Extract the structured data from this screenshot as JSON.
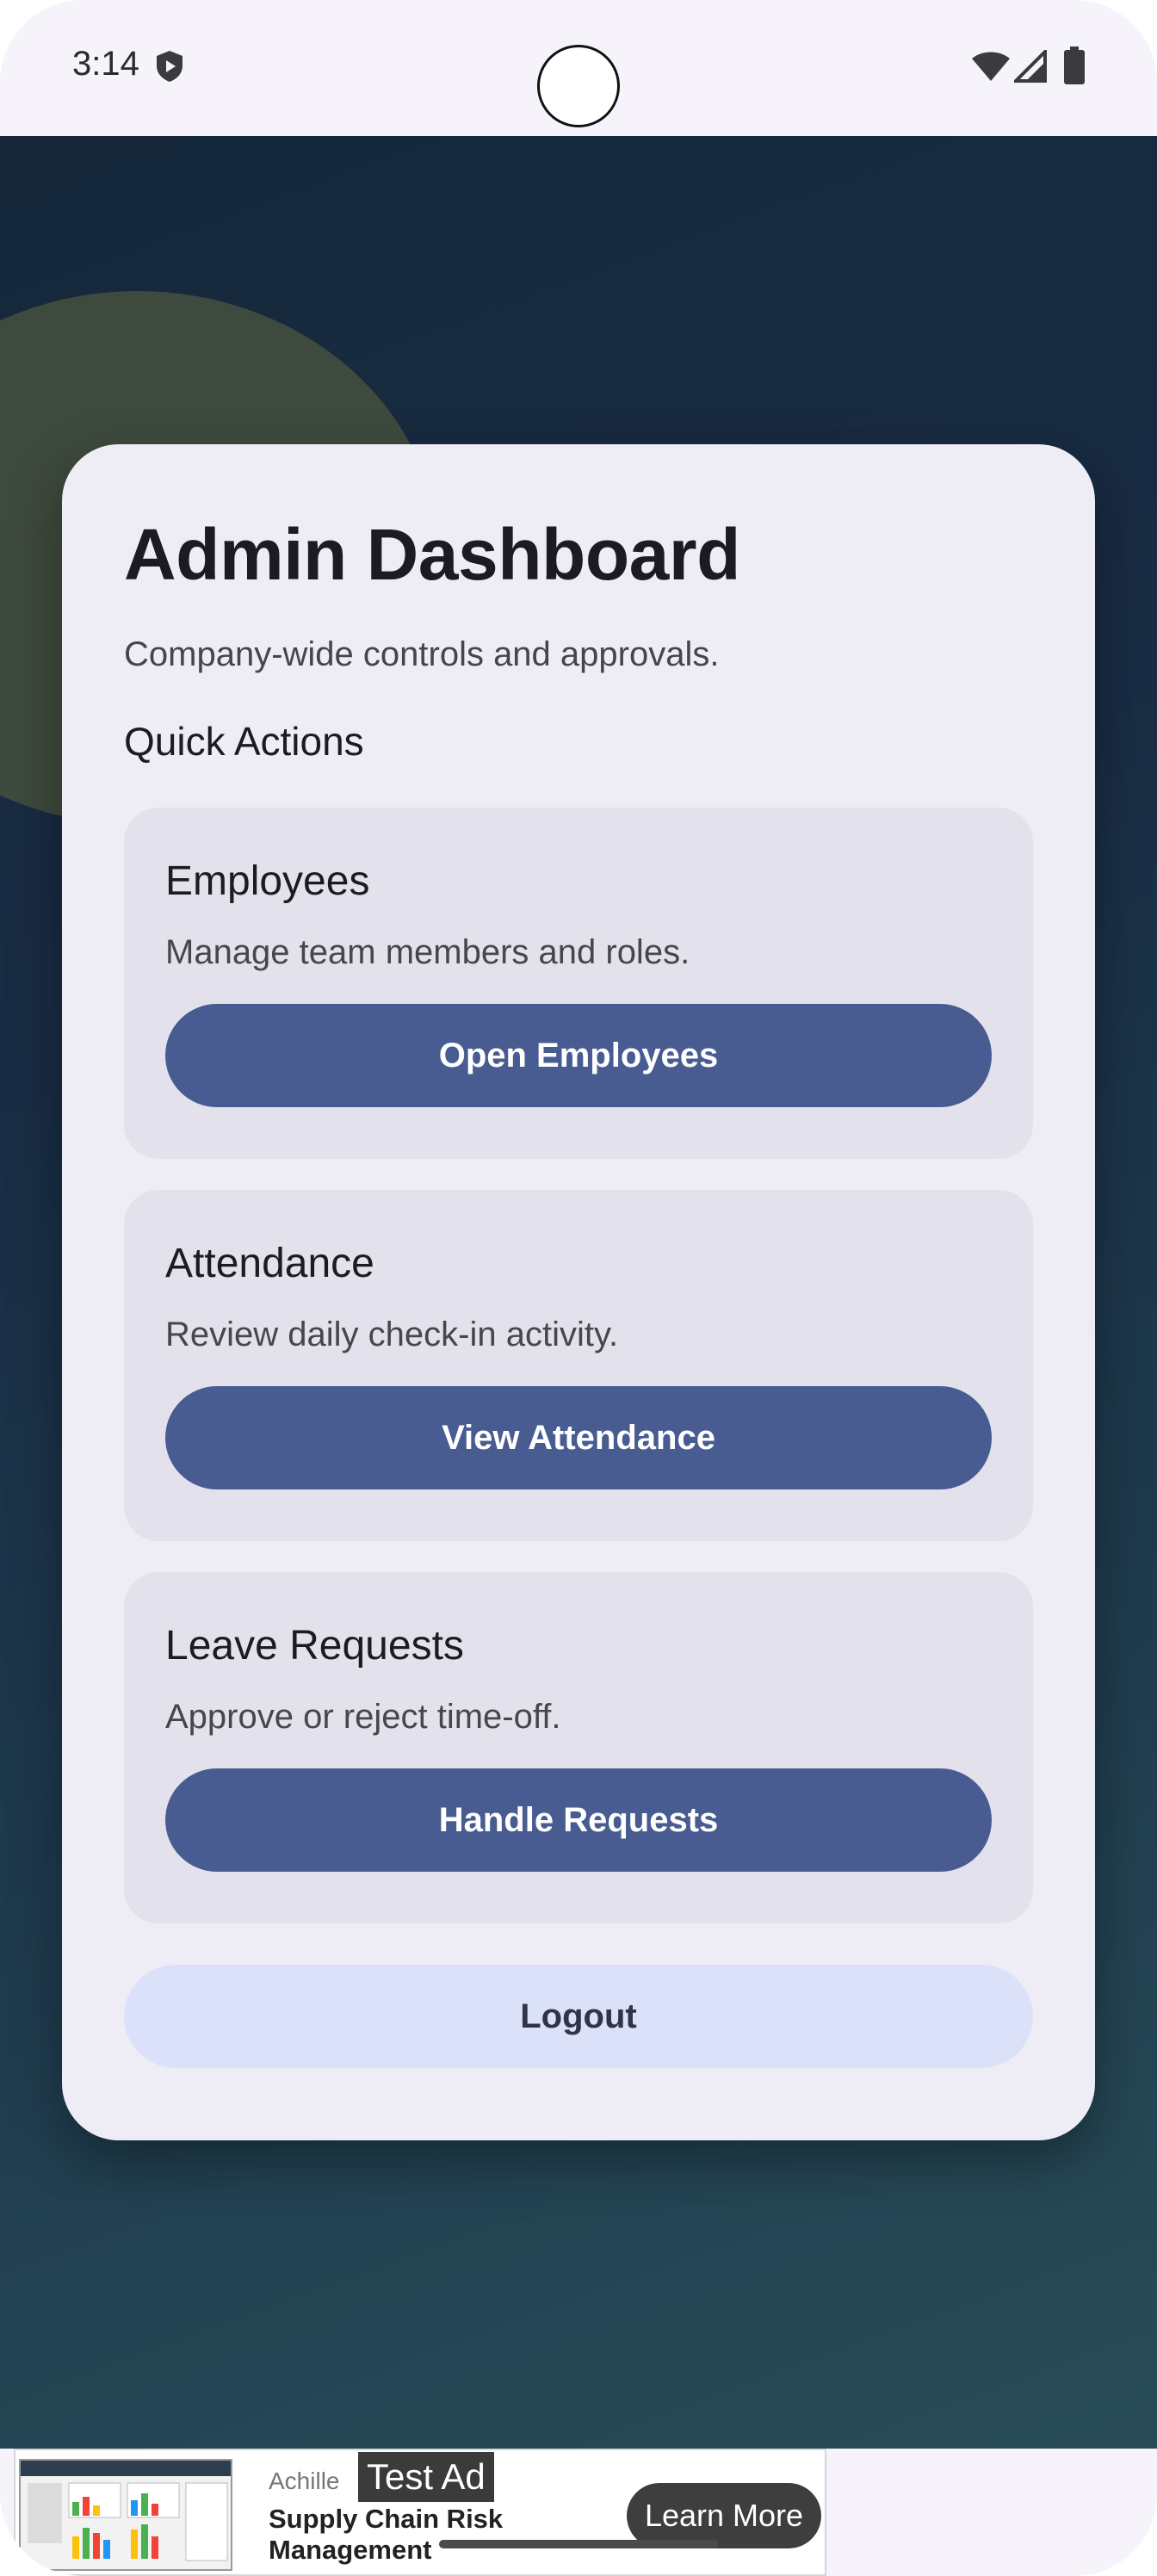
{
  "status_bar": {
    "time": "3:14"
  },
  "icons": {
    "shield": "shield-icon",
    "wifi": "wifi-icon",
    "signal": "signal-icon",
    "battery": "battery-icon"
  },
  "colors": {
    "primary_button": "#485c92",
    "logout_button": "#dbe1f8",
    "card_background": "#eeedf5",
    "action_card_background": "#e3e2ec"
  },
  "dashboard": {
    "title": "Admin Dashboard",
    "subtitle": "Company-wide controls and approvals.",
    "section_title": "Quick Actions",
    "actions": [
      {
        "title": "Employees",
        "description": "Manage team members and roles.",
        "button_label": "Open Employees"
      },
      {
        "title": "Attendance",
        "description": "Review daily check-in activity.",
        "button_label": "View Attendance"
      },
      {
        "title": "Leave Requests",
        "description": "Approve or reject time-off.",
        "button_label": "Handle Requests"
      }
    ],
    "logout_label": "Logout"
  },
  "ad": {
    "brand": "Achille",
    "badge": "Test Ad",
    "headline": "Supply Chain Risk Management",
    "cta": "Learn More"
  }
}
